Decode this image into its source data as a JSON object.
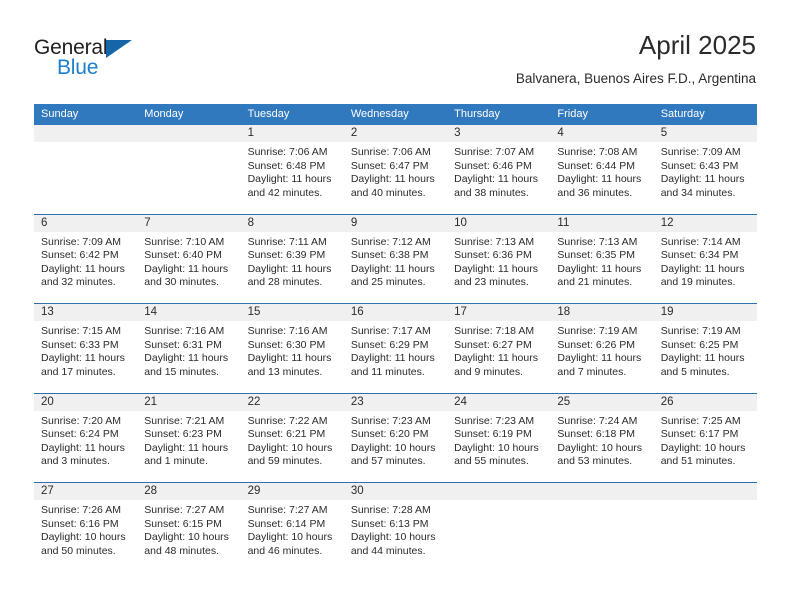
{
  "brand": {
    "name_top": "General",
    "name_bottom": "Blue",
    "triangle_color": "#1466a8",
    "blue_color": "#1b7fcc"
  },
  "header": {
    "title": "April 2025",
    "subtitle": "Balvanera, Buenos Aires F.D., Argentina"
  },
  "colors": {
    "header_bar": "#3179be",
    "week_separator": "#2f6fad",
    "day_band": "#f0f0f0",
    "text": "#2b2b2b"
  },
  "weekdays": [
    "Sunday",
    "Monday",
    "Tuesday",
    "Wednesday",
    "Thursday",
    "Friday",
    "Saturday"
  ],
  "weeks": [
    [
      {
        "day": "",
        "lines": []
      },
      {
        "day": "",
        "lines": []
      },
      {
        "day": "1",
        "lines": [
          "Sunrise: 7:06 AM",
          "Sunset: 6:48 PM",
          "Daylight: 11 hours",
          "and 42 minutes."
        ]
      },
      {
        "day": "2",
        "lines": [
          "Sunrise: 7:06 AM",
          "Sunset: 6:47 PM",
          "Daylight: 11 hours",
          "and 40 minutes."
        ]
      },
      {
        "day": "3",
        "lines": [
          "Sunrise: 7:07 AM",
          "Sunset: 6:46 PM",
          "Daylight: 11 hours",
          "and 38 minutes."
        ]
      },
      {
        "day": "4",
        "lines": [
          "Sunrise: 7:08 AM",
          "Sunset: 6:44 PM",
          "Daylight: 11 hours",
          "and 36 minutes."
        ]
      },
      {
        "day": "5",
        "lines": [
          "Sunrise: 7:09 AM",
          "Sunset: 6:43 PM",
          "Daylight: 11 hours",
          "and 34 minutes."
        ]
      }
    ],
    [
      {
        "day": "6",
        "lines": [
          "Sunrise: 7:09 AM",
          "Sunset: 6:42 PM",
          "Daylight: 11 hours",
          "and 32 minutes."
        ]
      },
      {
        "day": "7",
        "lines": [
          "Sunrise: 7:10 AM",
          "Sunset: 6:40 PM",
          "Daylight: 11 hours",
          "and 30 minutes."
        ]
      },
      {
        "day": "8",
        "lines": [
          "Sunrise: 7:11 AM",
          "Sunset: 6:39 PM",
          "Daylight: 11 hours",
          "and 28 minutes."
        ]
      },
      {
        "day": "9",
        "lines": [
          "Sunrise: 7:12 AM",
          "Sunset: 6:38 PM",
          "Daylight: 11 hours",
          "and 25 minutes."
        ]
      },
      {
        "day": "10",
        "lines": [
          "Sunrise: 7:13 AM",
          "Sunset: 6:36 PM",
          "Daylight: 11 hours",
          "and 23 minutes."
        ]
      },
      {
        "day": "11",
        "lines": [
          "Sunrise: 7:13 AM",
          "Sunset: 6:35 PM",
          "Daylight: 11 hours",
          "and 21 minutes."
        ]
      },
      {
        "day": "12",
        "lines": [
          "Sunrise: 7:14 AM",
          "Sunset: 6:34 PM",
          "Daylight: 11 hours",
          "and 19 minutes."
        ]
      }
    ],
    [
      {
        "day": "13",
        "lines": [
          "Sunrise: 7:15 AM",
          "Sunset: 6:33 PM",
          "Daylight: 11 hours",
          "and 17 minutes."
        ]
      },
      {
        "day": "14",
        "lines": [
          "Sunrise: 7:16 AM",
          "Sunset: 6:31 PM",
          "Daylight: 11 hours",
          "and 15 minutes."
        ]
      },
      {
        "day": "15",
        "lines": [
          "Sunrise: 7:16 AM",
          "Sunset: 6:30 PM",
          "Daylight: 11 hours",
          "and 13 minutes."
        ]
      },
      {
        "day": "16",
        "lines": [
          "Sunrise: 7:17 AM",
          "Sunset: 6:29 PM",
          "Daylight: 11 hours",
          "and 11 minutes."
        ]
      },
      {
        "day": "17",
        "lines": [
          "Sunrise: 7:18 AM",
          "Sunset: 6:27 PM",
          "Daylight: 11 hours",
          "and 9 minutes."
        ]
      },
      {
        "day": "18",
        "lines": [
          "Sunrise: 7:19 AM",
          "Sunset: 6:26 PM",
          "Daylight: 11 hours",
          "and 7 minutes."
        ]
      },
      {
        "day": "19",
        "lines": [
          "Sunrise: 7:19 AM",
          "Sunset: 6:25 PM",
          "Daylight: 11 hours",
          "and 5 minutes."
        ]
      }
    ],
    [
      {
        "day": "20",
        "lines": [
          "Sunrise: 7:20 AM",
          "Sunset: 6:24 PM",
          "Daylight: 11 hours",
          "and 3 minutes."
        ]
      },
      {
        "day": "21",
        "lines": [
          "Sunrise: 7:21 AM",
          "Sunset: 6:23 PM",
          "Daylight: 11 hours",
          "and 1 minute."
        ]
      },
      {
        "day": "22",
        "lines": [
          "Sunrise: 7:22 AM",
          "Sunset: 6:21 PM",
          "Daylight: 10 hours",
          "and 59 minutes."
        ]
      },
      {
        "day": "23",
        "lines": [
          "Sunrise: 7:23 AM",
          "Sunset: 6:20 PM",
          "Daylight: 10 hours",
          "and 57 minutes."
        ]
      },
      {
        "day": "24",
        "lines": [
          "Sunrise: 7:23 AM",
          "Sunset: 6:19 PM",
          "Daylight: 10 hours",
          "and 55 minutes."
        ]
      },
      {
        "day": "25",
        "lines": [
          "Sunrise: 7:24 AM",
          "Sunset: 6:18 PM",
          "Daylight: 10 hours",
          "and 53 minutes."
        ]
      },
      {
        "day": "26",
        "lines": [
          "Sunrise: 7:25 AM",
          "Sunset: 6:17 PM",
          "Daylight: 10 hours",
          "and 51 minutes."
        ]
      }
    ],
    [
      {
        "day": "27",
        "lines": [
          "Sunrise: 7:26 AM",
          "Sunset: 6:16 PM",
          "Daylight: 10 hours",
          "and 50 minutes."
        ]
      },
      {
        "day": "28",
        "lines": [
          "Sunrise: 7:27 AM",
          "Sunset: 6:15 PM",
          "Daylight: 10 hours",
          "and 48 minutes."
        ]
      },
      {
        "day": "29",
        "lines": [
          "Sunrise: 7:27 AM",
          "Sunset: 6:14 PM",
          "Daylight: 10 hours",
          "and 46 minutes."
        ]
      },
      {
        "day": "30",
        "lines": [
          "Sunrise: 7:28 AM",
          "Sunset: 6:13 PM",
          "Daylight: 10 hours",
          "and 44 minutes."
        ]
      },
      {
        "day": "",
        "lines": []
      },
      {
        "day": "",
        "lines": []
      },
      {
        "day": "",
        "lines": []
      }
    ]
  ]
}
